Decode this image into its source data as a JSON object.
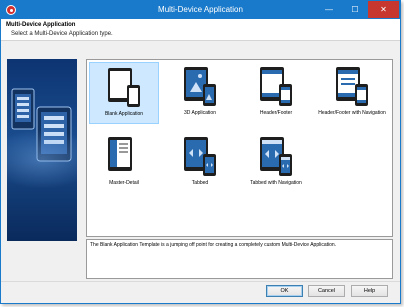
{
  "window": {
    "title": "Multi-Device Application"
  },
  "titlebar": {
    "minimize": "—",
    "maximize": "☐",
    "close": "✕"
  },
  "header": {
    "title": "Multi-Device Application",
    "subtitle": "Select a Multi-Device Application type."
  },
  "templates": [
    {
      "label": "Blank Application",
      "selected": true
    },
    {
      "label": "3D Application",
      "selected": false
    },
    {
      "label": "Header/Footer",
      "selected": false
    },
    {
      "label": "Header/Footer with Navigation",
      "selected": false
    },
    {
      "label": "Master-Detail",
      "selected": false
    },
    {
      "label": "Tabbed",
      "selected": false
    },
    {
      "label": "Tabbed with Navigation",
      "selected": false
    }
  ],
  "description": "The Blank Application Template is a jumping off point for creating a completely custom Multi-Device Application.",
  "buttons": {
    "ok": "OK",
    "cancel": "Cancel",
    "help": "Help"
  },
  "colors": {
    "titlebar": "#1979ca",
    "selection": "#cde8ff",
    "device_frame": "#1e1e1e",
    "device_accent": "#2a6bb0"
  }
}
